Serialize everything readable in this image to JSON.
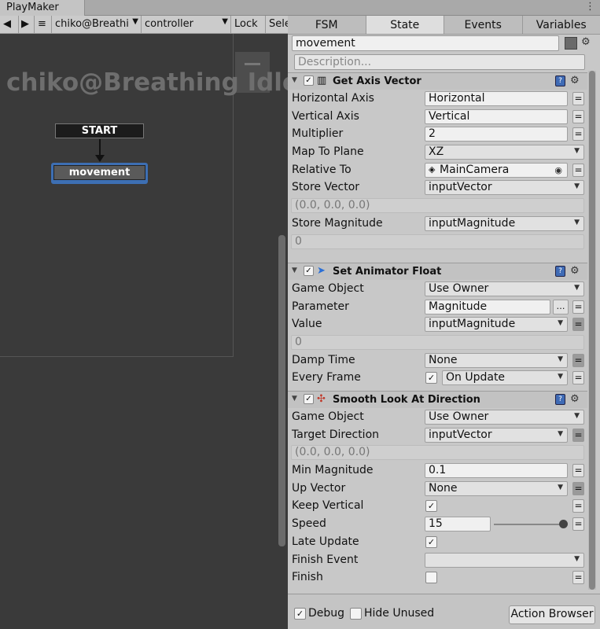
{
  "window": {
    "title": "PlayMaker"
  },
  "toolbar": {
    "object_selector": "chiko@Breathi",
    "fsm_selector": "controller",
    "lock_label": "Lock",
    "select_label": "Sele"
  },
  "canvas": {
    "watermark": "chiko@Breathing Idle",
    "start_label": "START",
    "state_label": "movement"
  },
  "tabs": [
    "FSM",
    "State",
    "Events",
    "Variables"
  ],
  "state": {
    "name": "movement",
    "description_placeholder": "Description..."
  },
  "actions": [
    {
      "name": "Get Axis Vector",
      "enabled": true,
      "rows": [
        {
          "label": "Horizontal Axis",
          "value": "Horizontal"
        },
        {
          "label": "Vertical Axis",
          "value": "Vertical"
        },
        {
          "label": "Multiplier",
          "value": "2"
        },
        {
          "label": "Map To Plane",
          "value": "XZ"
        },
        {
          "label": "Relative To",
          "value": "MainCamera"
        },
        {
          "label": "Store Vector",
          "value": "inputVector",
          "readout": "(0.0, 0.0, 0.0)"
        },
        {
          "label": "Store Magnitude",
          "value": "inputMagnitude",
          "readout": "0"
        }
      ]
    },
    {
      "name": "Set Animator Float",
      "enabled": true,
      "rows": [
        {
          "label": "Game Object",
          "value": "Use Owner"
        },
        {
          "label": "Parameter",
          "value": "Magnitude"
        },
        {
          "label": "Value",
          "value": "inputMagnitude",
          "readout": "0"
        },
        {
          "label": "Damp Time",
          "value": "None"
        },
        {
          "label": "Every Frame",
          "value": "On Update",
          "checked": true
        }
      ]
    },
    {
      "name": "Smooth Look At Direction",
      "enabled": true,
      "rows": [
        {
          "label": "Game Object",
          "value": "Use Owner"
        },
        {
          "label": "Target Direction",
          "value": "inputVector",
          "readout": "(0.0, 0.0, 0.0)"
        },
        {
          "label": "Min Magnitude",
          "value": "0.1"
        },
        {
          "label": "Up Vector",
          "value": "None"
        },
        {
          "label": "Keep Vertical",
          "checked": true
        },
        {
          "label": "Speed",
          "value": "15"
        },
        {
          "label": "Late Update",
          "checked": true
        },
        {
          "label": "Finish Event",
          "value": ""
        },
        {
          "label": "Finish",
          "checked": false
        }
      ]
    }
  ],
  "footer": {
    "debug_label": "Debug",
    "debug_checked": true,
    "hide_unused_label": "Hide Unused",
    "hide_unused_checked": false,
    "action_browser_label": "Action Browser"
  }
}
